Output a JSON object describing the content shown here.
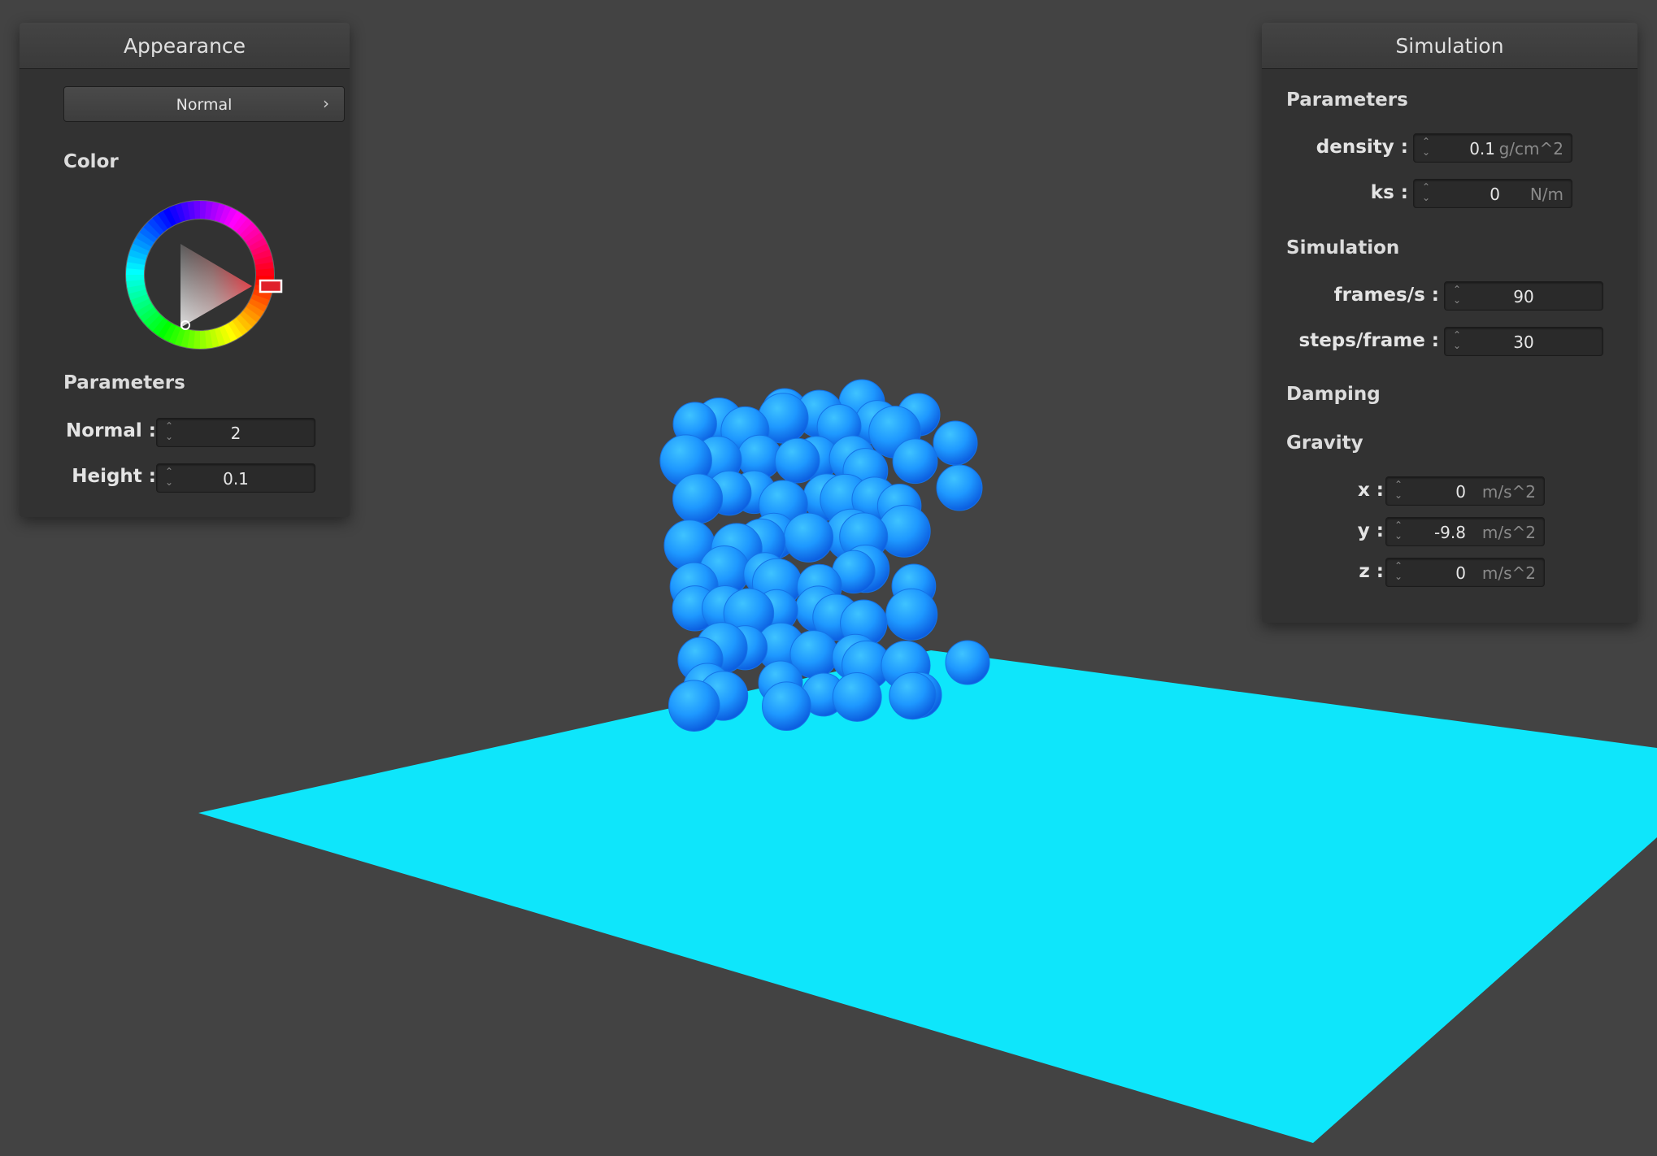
{
  "appearance": {
    "title": "Appearance",
    "mode_dropdown": "Normal",
    "color_label": "Color",
    "params_label": "Parameters",
    "normal_label": "Normal :",
    "normal_value": "2",
    "height_label": "Height :",
    "height_value": "0.1"
  },
  "simulation": {
    "title": "Simulation",
    "params_label": "Parameters",
    "density_label": "density :",
    "density_value": "0.1",
    "density_unit": "g/cm^2",
    "ks_label": "ks :",
    "ks_value": "0",
    "ks_unit": "N/m",
    "sim_label": "Simulation",
    "fps_label": "frames/s :",
    "fps_value": "90",
    "steps_label": "steps/frame :",
    "steps_value": "30",
    "damping_label": "Damping",
    "gravity_label": "Gravity",
    "gx_label": "x :",
    "gx_value": "0",
    "gx_unit": "m/s^2",
    "gy_label": "y :",
    "gy_value": "-9.8",
    "gy_unit": "m/s^2",
    "gz_label": "z :",
    "gz_value": "0",
    "gz_unit": "m/s^2"
  },
  "colors": {
    "background": "#434343",
    "floor": "#0ee6fb",
    "particles": "#1a96ff",
    "selected_color": "#e0202a"
  }
}
